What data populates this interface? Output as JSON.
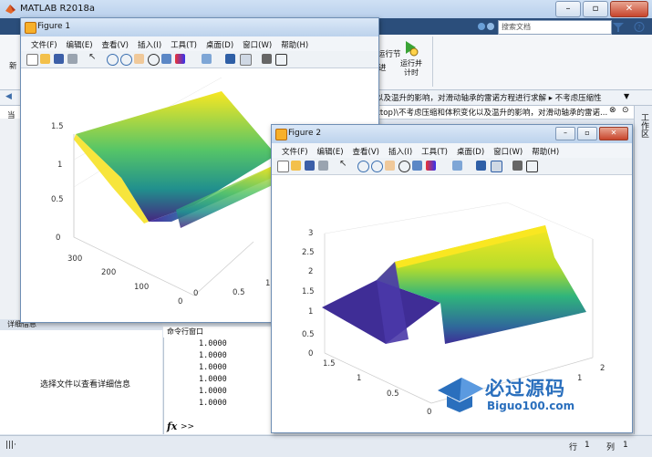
{
  "app": {
    "title": "MATLAB R2018a",
    "search_placeholder": "搜索文档",
    "ribbon": {
      "new_label": "新",
      "run_section_label": "运行节",
      "advance_label": "进",
      "run_time_label": "运行并计时"
    },
    "path_line1": "以及温升的影响，对滑动轴承的雷诺方程进行求解  ▸ 不考虑压缩性",
    "path_line2": "ktop)\\不考虑压缩和体积变化以及温升的影响，对滑动轴承的雷诺...",
    "side_label": "工作区",
    "current_folder_label": "当",
    "detail_header": "详细信息",
    "detail_text": "选择文件以查看详细信息",
    "command_window_title": "命令行窗口",
    "command_lines": [
      "1.0000",
      "1.0000",
      "1.0000",
      "1.0000",
      "1.0000",
      "1.0000"
    ],
    "prompt": ">>",
    "status": {
      "row_label": "行",
      "row": "1",
      "col_label": "列",
      "col": "1"
    }
  },
  "figure1": {
    "title": "Figure 1",
    "menu": [
      "文件(F)",
      "编辑(E)",
      "查看(V)",
      "插入(I)",
      "工具(T)",
      "桌面(D)",
      "窗口(W)",
      "帮助(H)"
    ],
    "z_ticks": [
      "0",
      "0.5",
      "1",
      "1.5"
    ],
    "y_ticks": [
      "0",
      "100",
      "200",
      "300"
    ],
    "x_ticks": [
      "0",
      "0.5",
      "1"
    ]
  },
  "figure2": {
    "title": "Figure 2",
    "menu": [
      "文件(F)",
      "编辑(E)",
      "查看(V)",
      "插入(I)",
      "工具(T)",
      "桌面(D)",
      "窗口(W)",
      "帮助(H)"
    ],
    "z_ticks": [
      "0",
      "0.5",
      "1",
      "1.5",
      "2",
      "2.5",
      "3"
    ],
    "y_ticks": [
      "0",
      "0.5",
      "1",
      "1.5"
    ],
    "x_ticks": [
      "1",
      "2"
    ]
  },
  "watermark": {
    "text_cn": "必过源码",
    "text_en": "Biguo100.com"
  },
  "colors": {
    "accent": "#2a6fbd",
    "surface_low": "#4a2fa0",
    "surface_mid": "#1fa6a0",
    "surface_high": "#f8e629"
  }
}
